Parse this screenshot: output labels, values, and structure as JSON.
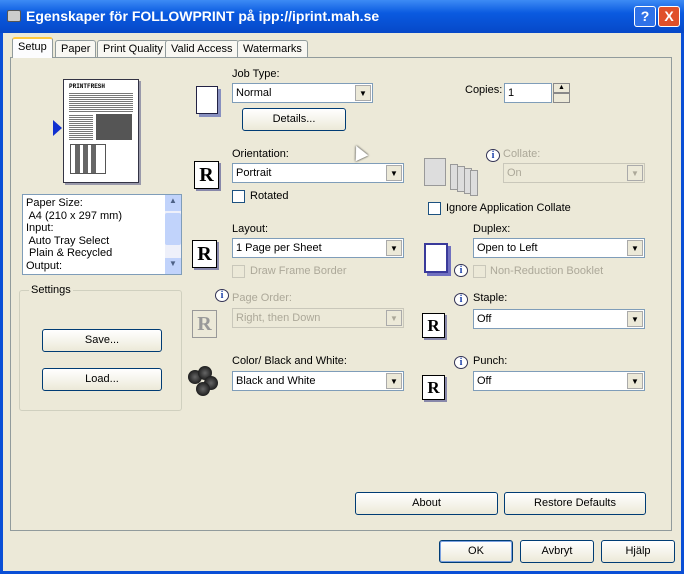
{
  "window": {
    "title": "Egenskaper för FOLLOWPRINT på ipp://iprint.mah.se",
    "help": "?",
    "close": "X"
  },
  "tabs": [
    "Setup",
    "Paper",
    "Print Quality",
    "Valid Access",
    "Watermarks"
  ],
  "summary": {
    "lines": [
      "Paper Size:",
      " A4 (210 x 297 mm)",
      "Input:",
      " Auto Tray Select",
      " Plain & Recycled",
      "Output:"
    ]
  },
  "settings": {
    "title": "Settings",
    "save": "Save...",
    "load": "Load..."
  },
  "job_type": {
    "label": "Job Type:",
    "value": "Normal",
    "details": "Details..."
  },
  "orientation": {
    "label": "Orientation:",
    "value": "Portrait",
    "rotated": "Rotated"
  },
  "layout": {
    "label": "Layout:",
    "value": "1 Page per Sheet",
    "frame": "Draw Frame Border"
  },
  "page_order": {
    "label": "Page Order:",
    "value": "Right, then Down"
  },
  "color": {
    "label": "Color/ Black and White:",
    "value": "Black and White"
  },
  "copies": {
    "label": "Copies:",
    "value": "1"
  },
  "collate": {
    "label": "Collate:",
    "value": "On",
    "ignore": "Ignore Application Collate"
  },
  "duplex": {
    "label": "Duplex:",
    "value": "Open to Left",
    "booklet": "Non-Reduction Booklet"
  },
  "staple": {
    "label": "Staple:",
    "value": "Off"
  },
  "punch": {
    "label": "Punch:",
    "value": "Off"
  },
  "buttons": {
    "about": "About",
    "restore": "Restore Defaults",
    "ok": "OK",
    "cancel": "Avbryt",
    "help": "Hjälp"
  },
  "preview": {
    "masthead": "PRINTFRESH"
  }
}
